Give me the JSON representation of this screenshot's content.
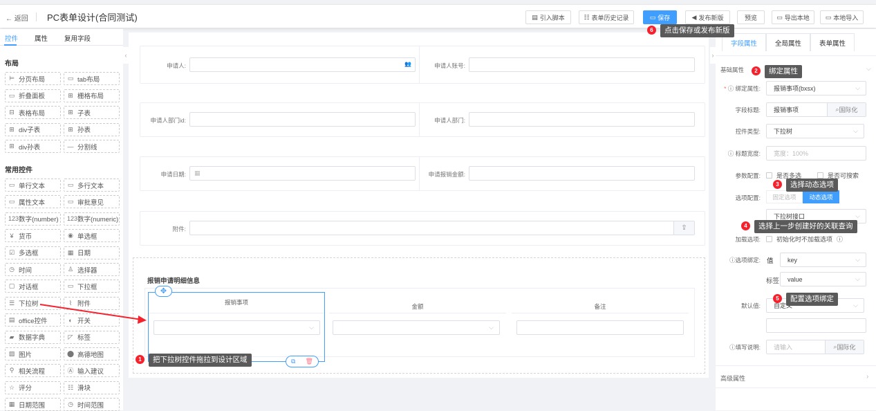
{
  "header": {
    "back": "返回",
    "title": "PC表单设计(合同测试)",
    "buttons": [
      "引入脚本",
      "表单历史记录",
      "保存",
      "发布新版",
      "预览",
      "导出本地",
      "本地导入"
    ]
  },
  "left": {
    "tabs": [
      "控件",
      "属性",
      "复用字段"
    ],
    "layout_title": "布局",
    "layout_items": [
      [
        "分页布局",
        "tab布局"
      ],
      [
        "折叠面板",
        "栅格布局"
      ],
      [
        "表格布局",
        "子表"
      ],
      [
        "div子表",
        "孙表"
      ],
      [
        "div孙表",
        "分割线"
      ]
    ],
    "common_title": "常用控件",
    "common_items": [
      [
        "单行文本",
        "多行文本"
      ],
      [
        "属性文本",
        "审批意见"
      ],
      [
        "数字(number)",
        "数字(numeric)"
      ],
      [
        "货币",
        "单选框"
      ],
      [
        "多选框",
        "日期"
      ],
      [
        "时间",
        "选择器"
      ],
      [
        "对话框",
        "下拉框"
      ],
      [
        "下拉树",
        "附件"
      ],
      [
        "office控件",
        "开关"
      ],
      [
        "数据字典",
        "标签"
      ],
      [
        "图片",
        "高德地图"
      ],
      [
        "相关流程",
        "输入建议"
      ],
      [
        "评分",
        "滑块"
      ],
      [
        "日期范围",
        "时间范围"
      ]
    ]
  },
  "canvas": {
    "fields": {
      "applicant": "申请人:",
      "applicant_account": "申请人账号:",
      "dept_id": "申请人部门id:",
      "dept": "申请人部门:",
      "date": "申请日期:",
      "amount": "申请报销金额:",
      "attachment": "附件:"
    },
    "detail": {
      "title": "报销申请明细信息",
      "columns": [
        "报销事项",
        "金额",
        "备注"
      ]
    }
  },
  "right": {
    "tabs": [
      "字段属性",
      "全局属性",
      "表单属性"
    ],
    "basic": "基础属性",
    "advanced": "高级属性",
    "bind_label": "绑定属性:",
    "bind_value": "报销事项(bxsx)",
    "field_title_label": "字段标题:",
    "field_title_value": "报销事项",
    "i18n": "国际化",
    "control_type_label": "控件类型:",
    "control_type_value": "下拉树",
    "title_width_label": "标题宽度:",
    "title_width_placeholder": "宽度：100%",
    "param_label": "参数配置:",
    "multi": "是否多选",
    "searchable": "是否可搜索",
    "option_label": "选项配置:",
    "fixed": "固定选项",
    "dynamic": "动态选项",
    "api_value": "下拉树接口",
    "load_label": "加载选项:",
    "load_text": "初始化时不加载选项",
    "option_bind_label": "选项绑定:",
    "value_label": "值",
    "value_value": "key",
    "tag_label": "标签",
    "tag_value": "value",
    "default_label": "默认值:",
    "default_value": "自定义",
    "desc_label": "填写说明:",
    "desc_placeholder": "请输入"
  },
  "annotations": [
    {
      "n": "1",
      "text": "把下拉树控件拖拉到设计区域"
    },
    {
      "n": "2",
      "text": "绑定属性"
    },
    {
      "n": "3",
      "text": "选择动态选项"
    },
    {
      "n": "4",
      "text": "选择上一步创建好的关联查询"
    },
    {
      "n": "5",
      "text": "配置选项绑定"
    },
    {
      "n": "6",
      "text": "点击保存或发布新版"
    }
  ],
  "colors": {
    "primary": "#409eff",
    "badge": "#f5222d",
    "arrow": "#f5222d"
  }
}
